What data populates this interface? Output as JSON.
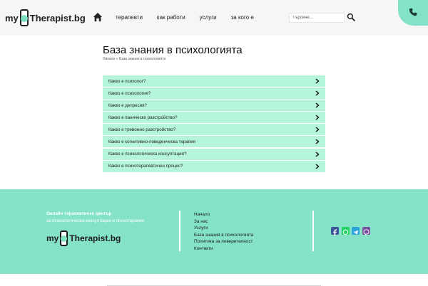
{
  "header": {
    "logo": {
      "prefix": "my",
      "brand": "Therapist.bg"
    },
    "nav": [
      "терапевти",
      "как работи",
      "услуги",
      "за кого е"
    ],
    "search": {
      "placeholder": "Търсене..."
    }
  },
  "main": {
    "title": "База знания в психологията",
    "breadcrumb": "Начало » База знания в психологията",
    "faq": [
      "Какво е психолог?",
      "Какво е психология?",
      "Какво е депресия?",
      "Какво е паническо разстройство?",
      "Какво е тревожно разстройство?",
      "Какво е когнитивно-поведенческа терапия",
      "Какво е психологическа консултация?",
      "Какво е психотерапевтичен процес?"
    ]
  },
  "footer": {
    "tagline_1": "Онлайн терапевтичен център",
    "tagline_2": "за психологическа консултация и психотерапия",
    "logo": {
      "prefix": "my",
      "brand": "Therapist.bg"
    },
    "links": [
      "Начало",
      "За нас",
      "Услуги",
      "База знания в психологията",
      "Политика за поверителност",
      "Контакти"
    ],
    "social_icons": [
      "facebook-icon",
      "whatsapp-icon",
      "telegram-icon",
      "viber-icon"
    ]
  },
  "colors": {
    "accent": "#84e3c7",
    "faq_bg": "#b4f5dc",
    "facebook": "#3b5998",
    "whatsapp": "#25d366",
    "telegram": "#2aa3dd",
    "viber": "#7b519d"
  }
}
